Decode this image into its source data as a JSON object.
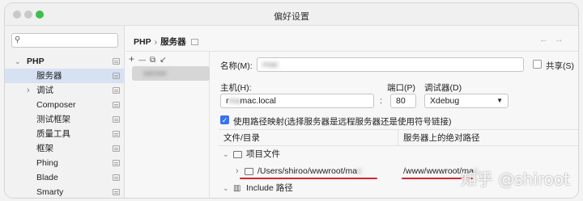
{
  "window": {
    "title": "偏好设置"
  },
  "sidebar": {
    "search_placeholder": "",
    "items": [
      {
        "label": "PHP",
        "bold": true,
        "arrow": "⌄",
        "indent": 1
      },
      {
        "label": "服务器",
        "selected": true,
        "indent": 2
      },
      {
        "label": "调试",
        "arrow": "›",
        "indent": 2
      },
      {
        "label": "Composer",
        "indent": 2
      },
      {
        "label": "测试框架",
        "indent": 2
      },
      {
        "label": "质量工具",
        "indent": 2
      },
      {
        "label": "框架",
        "indent": 2
      },
      {
        "label": "Phing",
        "indent": 2
      },
      {
        "label": "Blade",
        "indent": 2
      },
      {
        "label": "Smarty",
        "indent": 2
      }
    ]
  },
  "breadcrumb": {
    "parent": "PHP",
    "separator": "›",
    "current": "服务器"
  },
  "nav": {
    "back": "←",
    "forward": "→"
  },
  "toolbar": {
    "add": "+",
    "remove": "—",
    "copy": "⧉",
    "import": "↙"
  },
  "server_list": {
    "item": "server"
  },
  "form": {
    "name_label": "名称(M):",
    "name_value": "mac",
    "share_label": "共享(S)",
    "host_label": "主机(H):",
    "host_value_prefix": "r",
    "host_value": "mac.local",
    "port_label": "端口(P)",
    "port_value": "80",
    "debugger_label": "调试器(D)",
    "debugger_value": "Xdebug",
    "path_mapping_label": "使用路径映射(选择服务器是远程服务器还是使用符号链接)",
    "colon": ":"
  },
  "table": {
    "col1": "文件/目录",
    "col2": "服务器上的绝对路径",
    "rows": [
      {
        "label": "项目文件"
      },
      {
        "label": "/Users/shiroo/wwwroot/ma",
        "blurred": "c",
        "server_path": "/www/wwwroot/ma",
        "server_blurred": "c"
      },
      {
        "label": "Include 路径"
      }
    ]
  },
  "watermark": "知乎 @shiroot",
  "colors": {
    "accent": "#3574f0",
    "underline": "#d9252b",
    "selection": "#d6e1f3"
  }
}
